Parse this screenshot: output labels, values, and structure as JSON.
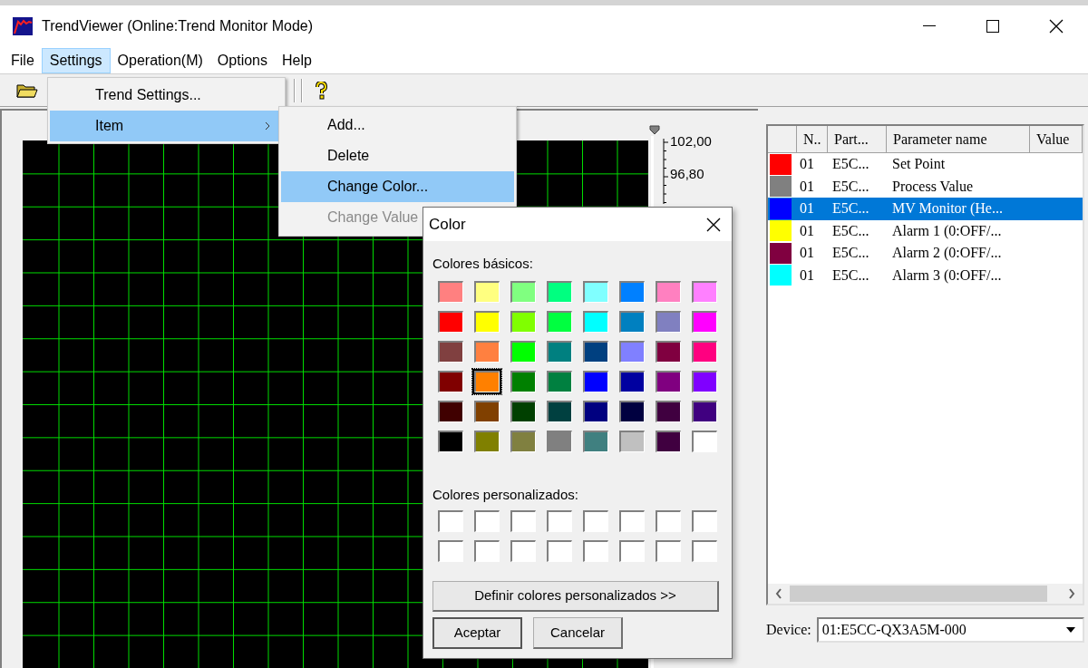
{
  "window": {
    "title": "TrendViewer (Online:Trend Monitor Mode)"
  },
  "menu_bar": [
    {
      "label": "File",
      "selected": false
    },
    {
      "label": "Settings",
      "selected": true
    },
    {
      "label": "Operation(M)",
      "selected": false
    },
    {
      "label": "Options",
      "selected": false
    },
    {
      "label": "Help",
      "selected": false
    }
  ],
  "settings_menu": [
    {
      "label": "Trend Settings...",
      "selected": false,
      "submenu": false
    },
    {
      "label": "Item",
      "selected": true,
      "submenu": true
    }
  ],
  "item_submenu": [
    {
      "label": "Add...",
      "selected": false,
      "disabled": false
    },
    {
      "label": "Delete",
      "selected": false,
      "disabled": false
    },
    {
      "label": "Change Color...",
      "selected": true,
      "disabled": false
    },
    {
      "label": "Change Value",
      "selected": false,
      "disabled": true
    }
  ],
  "y_axis_labels": [
    "102,00",
    "96,80"
  ],
  "table": {
    "columns": [
      "N..",
      "Part...",
      "Parameter name",
      "Value"
    ],
    "rows": [
      {
        "color": "#ff0000",
        "no": "01",
        "part": "E5C...",
        "parameter": "Set Point",
        "selected": false
      },
      {
        "color": "#808080",
        "no": "01",
        "part": "E5C...",
        "parameter": "Process Value",
        "selected": false
      },
      {
        "color": "#0000ff",
        "no": "01",
        "part": "E5C...",
        "parameter": "MV Monitor (He...",
        "selected": true
      },
      {
        "color": "#ffff00",
        "no": "01",
        "part": "E5C...",
        "parameter": "Alarm 1 (0:OFF/...",
        "selected": false
      },
      {
        "color": "#800040",
        "no": "01",
        "part": "E5C...",
        "parameter": "Alarm 2 (0:OFF/...",
        "selected": false
      },
      {
        "color": "#00ffff",
        "no": "01",
        "part": "E5C...",
        "parameter": "Alarm 3 (0:OFF/...",
        "selected": false
      }
    ]
  },
  "device": {
    "label": "Device:",
    "value": "01:E5CC-QX3A5M-000"
  },
  "color_dialog": {
    "title": "Color",
    "basic_label": "Colores básicos:",
    "basic_colors": [
      {
        "color": "#ff8080",
        "selected": false
      },
      {
        "color": "#ffff80",
        "selected": false
      },
      {
        "color": "#80ff80",
        "selected": false
      },
      {
        "color": "#00ff80",
        "selected": false
      },
      {
        "color": "#80ffff",
        "selected": false
      },
      {
        "color": "#0080ff",
        "selected": false
      },
      {
        "color": "#ff80c0",
        "selected": false
      },
      {
        "color": "#ff80ff",
        "selected": false
      },
      {
        "color": "#ff0000",
        "selected": false
      },
      {
        "color": "#ffff00",
        "selected": false
      },
      {
        "color": "#80ff00",
        "selected": false
      },
      {
        "color": "#00ff40",
        "selected": false
      },
      {
        "color": "#00ffff",
        "selected": false
      },
      {
        "color": "#0080c0",
        "selected": false
      },
      {
        "color": "#8080c0",
        "selected": false
      },
      {
        "color": "#ff00ff",
        "selected": false
      },
      {
        "color": "#804040",
        "selected": false
      },
      {
        "color": "#ff8040",
        "selected": false
      },
      {
        "color": "#00ff00",
        "selected": false
      },
      {
        "color": "#008080",
        "selected": false
      },
      {
        "color": "#004080",
        "selected": false
      },
      {
        "color": "#8080ff",
        "selected": false
      },
      {
        "color": "#800040",
        "selected": false
      },
      {
        "color": "#ff0080",
        "selected": false
      },
      {
        "color": "#800000",
        "selected": false
      },
      {
        "color": "#ff8000",
        "selected": true
      },
      {
        "color": "#008000",
        "selected": false
      },
      {
        "color": "#008040",
        "selected": false
      },
      {
        "color": "#0000ff",
        "selected": false
      },
      {
        "color": "#0000a0",
        "selected": false
      },
      {
        "color": "#800080",
        "selected": false
      },
      {
        "color": "#8000ff",
        "selected": false
      },
      {
        "color": "#400000",
        "selected": false
      },
      {
        "color": "#804000",
        "selected": false
      },
      {
        "color": "#004000",
        "selected": false
      },
      {
        "color": "#004040",
        "selected": false
      },
      {
        "color": "#000080",
        "selected": false
      },
      {
        "color": "#000040",
        "selected": false
      },
      {
        "color": "#400040",
        "selected": false
      },
      {
        "color": "#400080",
        "selected": false
      },
      {
        "color": "#000000",
        "selected": false
      },
      {
        "color": "#808000",
        "selected": false
      },
      {
        "color": "#808040",
        "selected": false
      },
      {
        "color": "#808080",
        "selected": false
      },
      {
        "color": "#408080",
        "selected": false
      },
      {
        "color": "#c0c0c0",
        "selected": false
      },
      {
        "color": "#400040",
        "selected": false
      },
      {
        "color": "#ffffff",
        "selected": false
      }
    ],
    "custom_label": "Colores personalizados:",
    "custom_colors": [
      {
        "color": "#ffffff"
      },
      {
        "color": "#ffffff"
      },
      {
        "color": "#ffffff"
      },
      {
        "color": "#ffffff"
      },
      {
        "color": "#ffffff"
      },
      {
        "color": "#ffffff"
      },
      {
        "color": "#ffffff"
      },
      {
        "color": "#ffffff"
      },
      {
        "color": "#ffffff"
      },
      {
        "color": "#ffffff"
      },
      {
        "color": "#ffffff"
      },
      {
        "color": "#ffffff"
      },
      {
        "color": "#ffffff"
      },
      {
        "color": "#ffffff"
      },
      {
        "color": "#ffffff"
      },
      {
        "color": "#ffffff"
      }
    ],
    "define_button": "Definir colores personalizados >>",
    "ok_button": "Aceptar",
    "cancel_button": "Cancelar"
  }
}
